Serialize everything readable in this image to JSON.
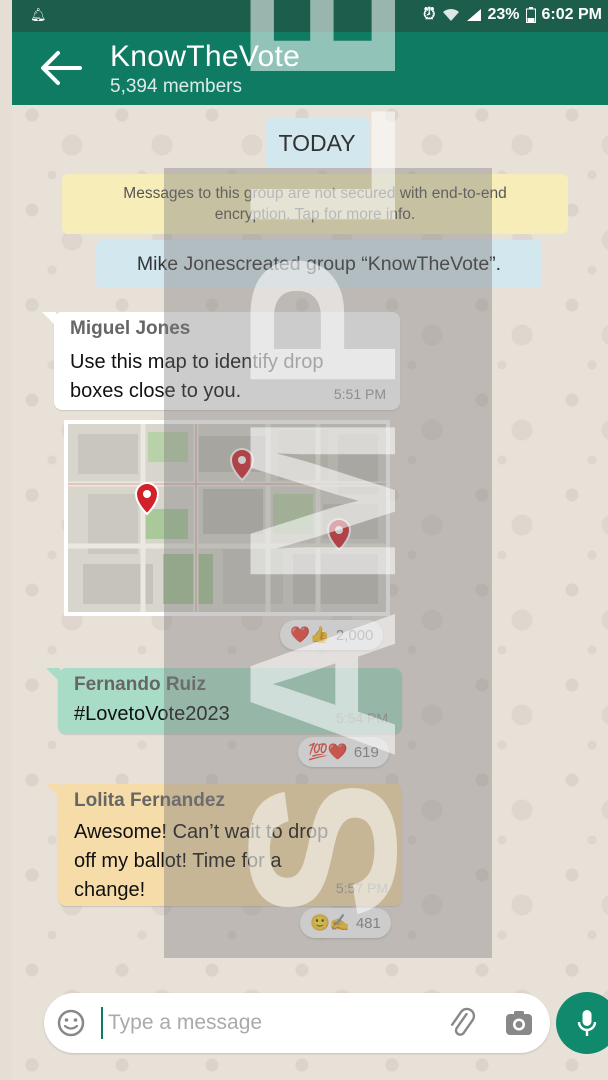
{
  "status_bar": {
    "notification_icon": "bell-icon",
    "battery_percent": "23%",
    "time": "6:02 PM"
  },
  "header": {
    "title": "KnowTheVote",
    "subtitle": "5,394 members",
    "back_icon": "arrow-left-icon"
  },
  "chat": {
    "date_label": "TODAY",
    "encryption_notice_line1": "Messages to this group are not secured with end-to-end",
    "encryption_notice_line2": "encryption. Tap for more info.",
    "system_message": "Mike Jonescreated group “KnowTheVote”.",
    "messages": [
      {
        "sender": "Miguel Jones",
        "sender_color": "#666666",
        "text_line1": "Use this map to identify drop",
        "text_line2": "boxes close to you.",
        "time": "5:51 PM",
        "has_map": true,
        "reactions": "❤️👍",
        "reaction_count": "2,000"
      },
      {
        "sender": "Fernando Ruiz",
        "sender_color": "#6a6a6a",
        "text_line1": "#LovetoVote2023",
        "time": "5:54 PM",
        "bubble_color": "#a8dcc6",
        "reactions": "💯❤️",
        "reaction_count": "619"
      },
      {
        "sender": "Lolita Fernandez",
        "sender_color": "#6a6a6a",
        "text_line1": "Awesome! Can’t wait to drop",
        "text_line2": "off my ballot! Time for a",
        "text_line3": "change!",
        "time": "5:57 PM",
        "bubble_color": "#f5dca8",
        "reactions": "🙂✍️",
        "reaction_count": "481"
      }
    ]
  },
  "watermark": "SAMPLE",
  "composer": {
    "placeholder": "Type a message",
    "emoji_icon": "smiley-icon",
    "attach_icon": "paperclip-icon",
    "camera_icon": "camera-icon",
    "mic_icon": "microphone-icon"
  },
  "colors": {
    "header": "#0f7b63",
    "status_bar": "#1c5d4b",
    "mic_button": "#0f8a6c",
    "map_pin": "#d0222b"
  }
}
